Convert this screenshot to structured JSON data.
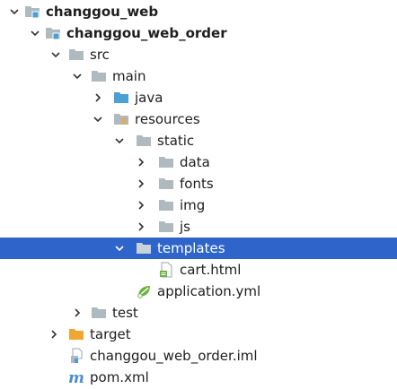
{
  "tree": {
    "items": [
      {
        "label": "changgou_web",
        "icon": "module-folder-icon",
        "expanded": true,
        "bold": true
      },
      {
        "label": "changgou_web_order",
        "icon": "module-folder-icon",
        "expanded": true,
        "bold": true
      },
      {
        "label": "src",
        "icon": "folder-icon",
        "expanded": true
      },
      {
        "label": "main",
        "icon": "folder-icon",
        "expanded": true
      },
      {
        "label": "java",
        "icon": "source-folder-icon",
        "expanded": false
      },
      {
        "label": "resources",
        "icon": "resources-folder-icon",
        "expanded": true
      },
      {
        "label": "static",
        "icon": "folder-icon",
        "expanded": true
      },
      {
        "label": "data",
        "icon": "folder-icon",
        "expanded": false
      },
      {
        "label": "fonts",
        "icon": "folder-icon",
        "expanded": false
      },
      {
        "label": "img",
        "icon": "folder-icon",
        "expanded": false
      },
      {
        "label": "js",
        "icon": "folder-icon",
        "expanded": false
      },
      {
        "label": "templates",
        "icon": "folder-icon",
        "expanded": true,
        "selected": true
      },
      {
        "label": "cart.html",
        "icon": "html-file-icon"
      },
      {
        "label": "application.yml",
        "icon": "spring-yml-icon"
      },
      {
        "label": "test",
        "icon": "folder-icon",
        "expanded": false
      },
      {
        "label": "target",
        "icon": "excluded-folder-icon",
        "expanded": false
      },
      {
        "label": "changgou_web_order.iml",
        "icon": "iml-file-icon"
      },
      {
        "label": "pom.xml",
        "icon": "maven-pom-icon"
      }
    ]
  },
  "colors": {
    "selection": "#2f65ca",
    "folder": "#aeb9c0",
    "source_folder": "#4a9fd6",
    "excluded_folder": "#f0a732",
    "maven": "#4a8fd6",
    "spring": "#6db33f"
  }
}
